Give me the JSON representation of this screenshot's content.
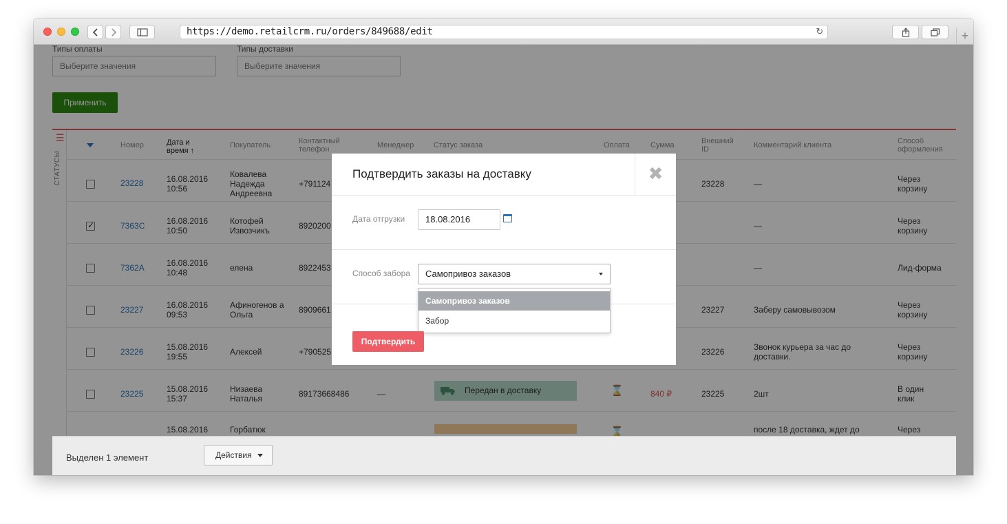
{
  "browser": {
    "url": "https://demo.retailcrm.ru/orders/849688/edit",
    "back_icon": "chevron-left-icon",
    "forward_icon": "chevron-right-icon",
    "reload_glyph": "↻",
    "new_tab_glyph": "+"
  },
  "filters": {
    "payment_types_label": "Типы оплаты",
    "payment_types_placeholder": "Выберите значения",
    "delivery_types_label": "Типы доставки",
    "delivery_types_placeholder": "Выберите значения",
    "apply_label": "Применить"
  },
  "sidebar_tab": {
    "label": "СТАТУСЫ"
  },
  "table": {
    "headers": {
      "number": "Номер",
      "datetime": "Дата и время ↑",
      "customer": "Покупатель",
      "phone": "Контактный телефон",
      "manager": "Менеджер",
      "status": "Статус заказа",
      "payment": "Оплата",
      "sum": "Сумма",
      "external_id": "Внешний ID",
      "comment": "Комментарий клиента",
      "method": "Способ оформления"
    },
    "rows": [
      {
        "checked": false,
        "number": "23228",
        "date": "16.08.2016",
        "time": "10:56",
        "customer": "Ковалева Надежда Андреевна",
        "phone": "+791124",
        "external_id": "23228",
        "comment": "—",
        "method": "Через корзину"
      },
      {
        "checked": true,
        "number": "7363C",
        "date": "16.08.2016",
        "time": "10:50",
        "customer": "Котофей Извозчикъ",
        "phone": "8920200",
        "external_id": "",
        "comment": "—",
        "method": "Через корзину"
      },
      {
        "checked": false,
        "number": "7362A",
        "date": "16.08.2016",
        "time": "10:48",
        "customer": "елена",
        "phone": "8922453",
        "external_id": "",
        "comment": "—",
        "method": "Лид-форма"
      },
      {
        "checked": false,
        "number": "23227",
        "date": "16.08.2016",
        "time": "09:53",
        "customer": "Афиногенов а Ольга",
        "phone": "8909661",
        "external_id": "23227",
        "comment": "Заберу самовывозом",
        "method": "Через корзину"
      },
      {
        "checked": false,
        "number": "23226",
        "date": "15.08.2016",
        "time": "19:55",
        "customer": "Алексей",
        "phone": "+790525",
        "external_id": "23226",
        "comment": "Звонок курьера за час до доставки.",
        "method": "Через корзину"
      },
      {
        "checked": false,
        "number": "23225",
        "date": "15.08.2016",
        "time": "15:37",
        "customer": "Низаева Наталья",
        "phone": "89173668486",
        "manager": "—",
        "status": "Передан в доставку",
        "sum": "840 ₽",
        "external_id": "23225",
        "comment": "2шт",
        "method": "В один клик"
      },
      {
        "checked": false,
        "number": "",
        "date": "15.08.2016",
        "time": "",
        "customer": "Горбатюк",
        "phone": "",
        "external_id": "",
        "comment": "после 18 доставка, ждет до",
        "method": "Через"
      }
    ]
  },
  "bottom_bar": {
    "selected_text": "Выделен 1 элемент",
    "actions_label": "Действия"
  },
  "modal": {
    "title": "Подтвердить заказы на доставку",
    "close_glyph": "✖",
    "ship_date_label": "Дата отгрузки",
    "ship_date_value": "18.08.2016",
    "pickup_label": "Способ забора",
    "pickup_value": "Самопривоз заказов",
    "pickup_options": [
      "Самопривоз заказов",
      "Забор"
    ],
    "confirm_label": "Подтвердить"
  },
  "colors": {
    "apply_green": "#2d8a10",
    "confirm_red": "#ee5c66",
    "link_blue": "#2a73b9",
    "status_green": "#b6d9c9",
    "money_red": "#d9534f"
  }
}
